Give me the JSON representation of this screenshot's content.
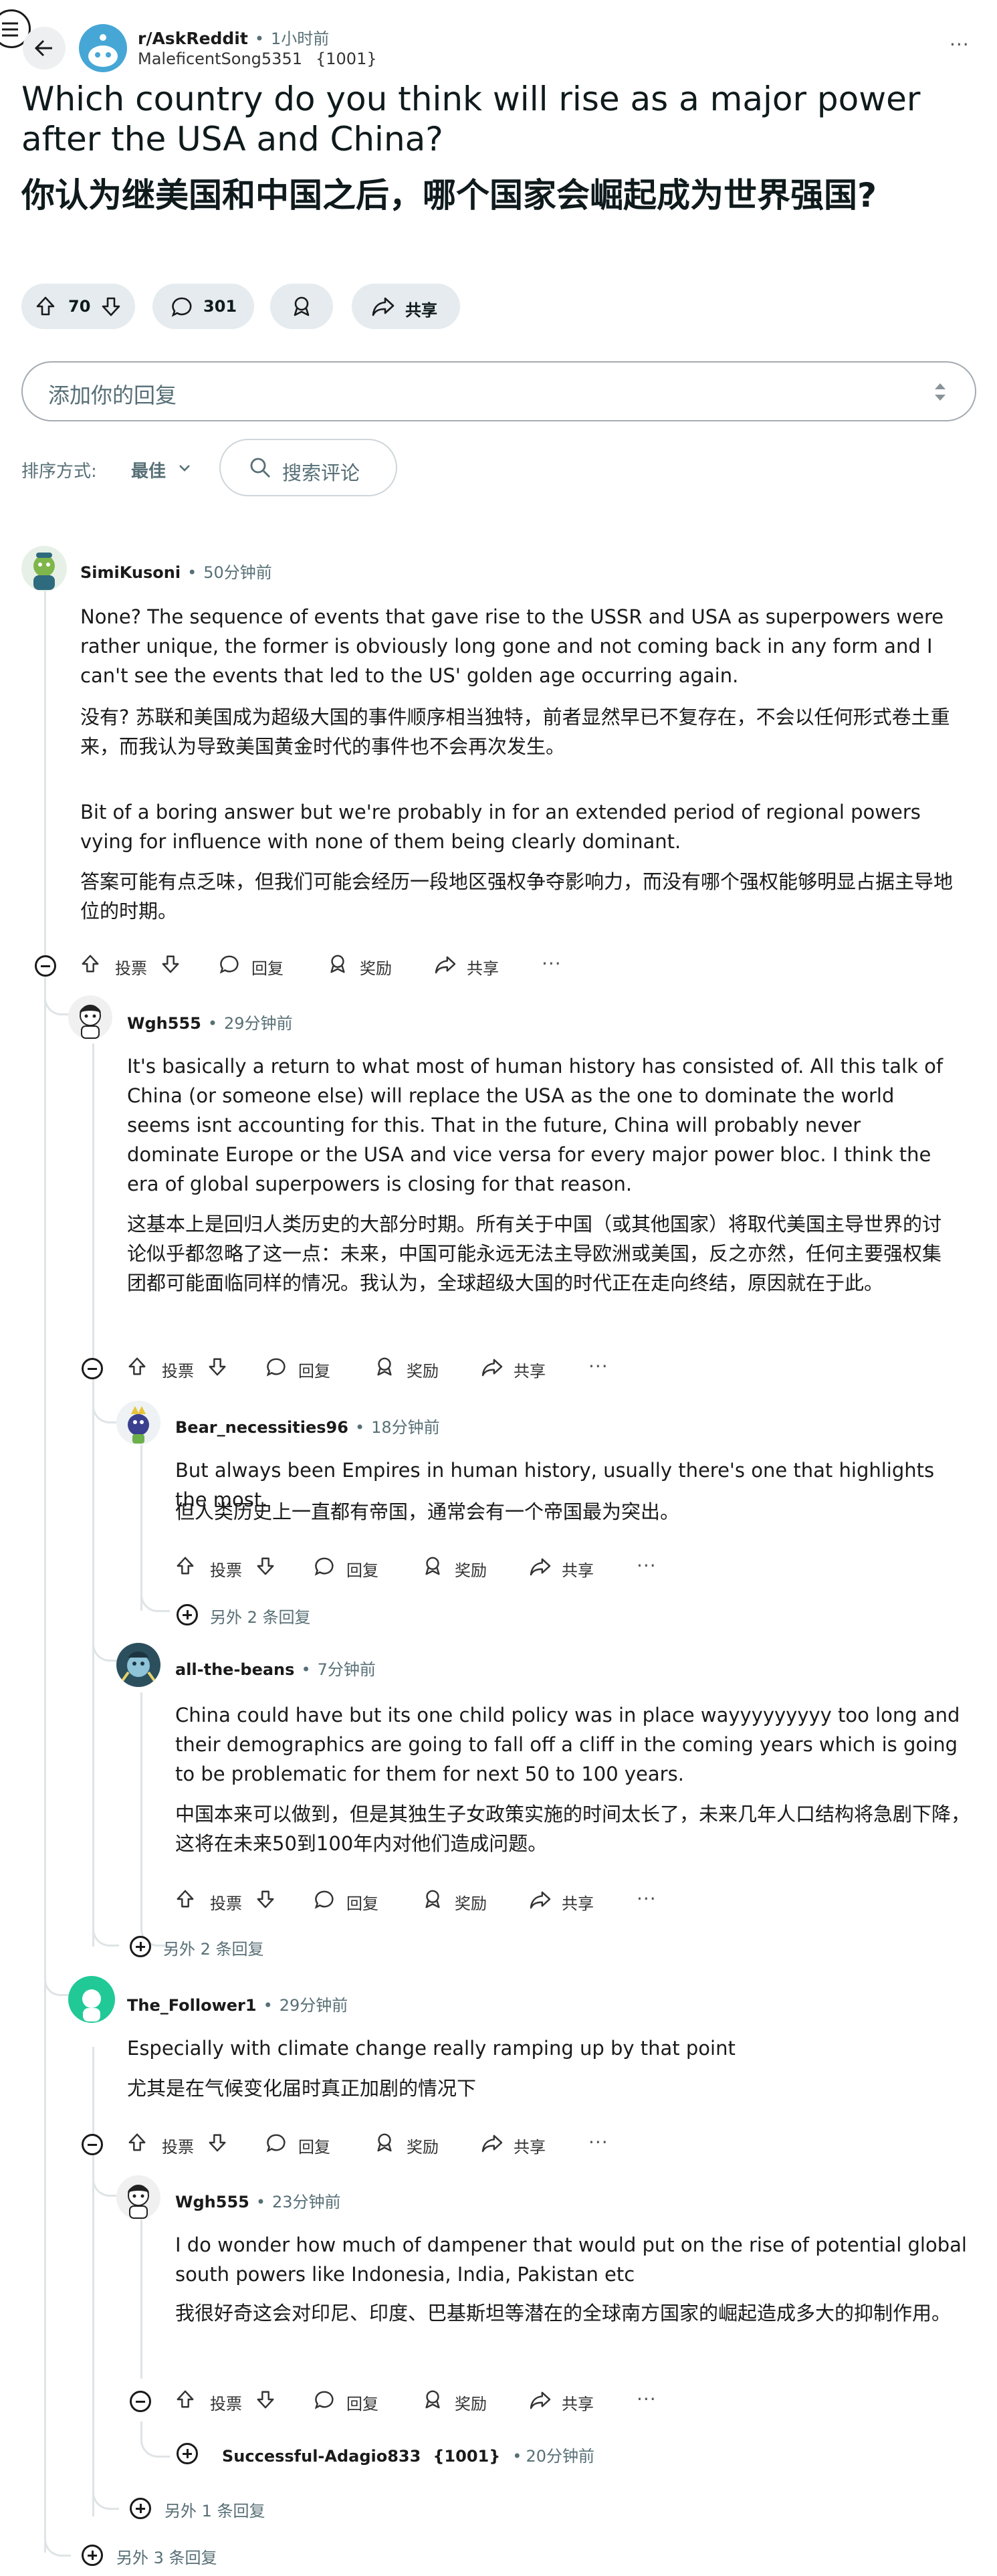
{
  "post": {
    "subreddit": "r/AskReddit",
    "time": "1小时前",
    "author": "MaleficentSong5351",
    "author_flair": "{1001}",
    "title_en": "Which country do you think will rise as a major power after the USA and China?",
    "title_zh": "你认为继美国和中国之后，哪个国家会崛起成为世界强国?",
    "votes": "70",
    "comments": "301",
    "share": "共享"
  },
  "reply_box": {
    "placeholder": "添加你的回复"
  },
  "sort": {
    "label": "排序方式:",
    "value": "最佳",
    "search_placeholder": "搜索评论"
  },
  "actions": {
    "vote": "投票",
    "reply": "回复",
    "award": "奖励",
    "share": "共享",
    "more": "···"
  },
  "comments": [
    {
      "user": "SimiKusoni",
      "time": "50分钟前",
      "p1": "None? The sequence of events that gave rise to the USSR and USA as superpowers were rather unique, the former is obviously long gone and not coming back in any form and I can't see the events that led to the US' golden age occurring again.",
      "p2": "没有? 苏联和美国成为超级大国的事件顺序相当独特，前者显然早已不复存在，不会以任何形式卷土重来，而我认为导致美国黄金时代的事件也不会再次发生。",
      "p3": "Bit of a boring answer but we're probably in for an extended period of regional powers vying for influence with none of them being clearly dominant.",
      "p4": "答案可能有点乏味，但我们可能会经历一段地区强权争夺影响力，而没有哪个强权能够明显占据主导地位的时期。"
    },
    {
      "user": "Wgh555",
      "time": "29分钟前",
      "p1": "It's basically a return to what most of human history has consisted of. All this talk of China (or someone else) will replace the USA as the one to dominate the world seems isnt accounting for this. That in the future, China will probably never dominate Europe or the USA and vice versa for every major power bloc. I think the era of global superpowers is closing for that reason.",
      "p2": "这基本上是回归人类历史的大部分时期。所有关于中国（或其他国家）将取代美国主导世界的讨论似乎都忽略了这一点：未来，中国可能永远无法主导欧洲或美国，反之亦然，任何主要强权集团都可能面临同样的情况。我认为，全球超级大国的时代正在走向终结，原因就在于此。"
    },
    {
      "user": "Bear_necessities96",
      "time": "18分钟前",
      "p1": "But always been Empires in human history, usually there's one that highlights the most.",
      "p2": "但人类历史上一直都有帝国，通常会有一个帝国最为突出。",
      "more": "另外 2 条回复"
    },
    {
      "user": "all-the-beans",
      "time": "7分钟前",
      "p1": "China could have but its one child policy was in place wayyyyyyyyy too long and their demographics are going to fall off a cliff in the coming years which is going to be problematic for them for next 50 to 100 years.",
      "p2": "中国本来可以做到，但是其独生子女政策实施的时间太长了，未来几年人口结构将急剧下降，这将在未来50到100年内对他们造成问题。",
      "more": "另外 2 条回复"
    },
    {
      "user": "The_Follower1",
      "time": "29分钟前",
      "p1": "Especially with climate change really ramping up by that point",
      "p2": "尤其是在气候变化届时真正加剧的情况下"
    },
    {
      "user": "Wgh555",
      "time": "23分钟前",
      "p1": "I do wonder how much of dampener that would put on the rise of potential global south powers like Indonesia, India, Pakistan etc",
      "p2": "我很好奇这会对印尼、印度、巴基斯坦等潜在的全球南方国家的崛起造成多大的抑制作用。"
    },
    {
      "user": "Successful-Adagio833",
      "flair": "{1001}",
      "time": "20分钟前"
    }
  ],
  "more_replies_1": "另外 1 条回复",
  "more_replies_3": "另外 3 条回复"
}
